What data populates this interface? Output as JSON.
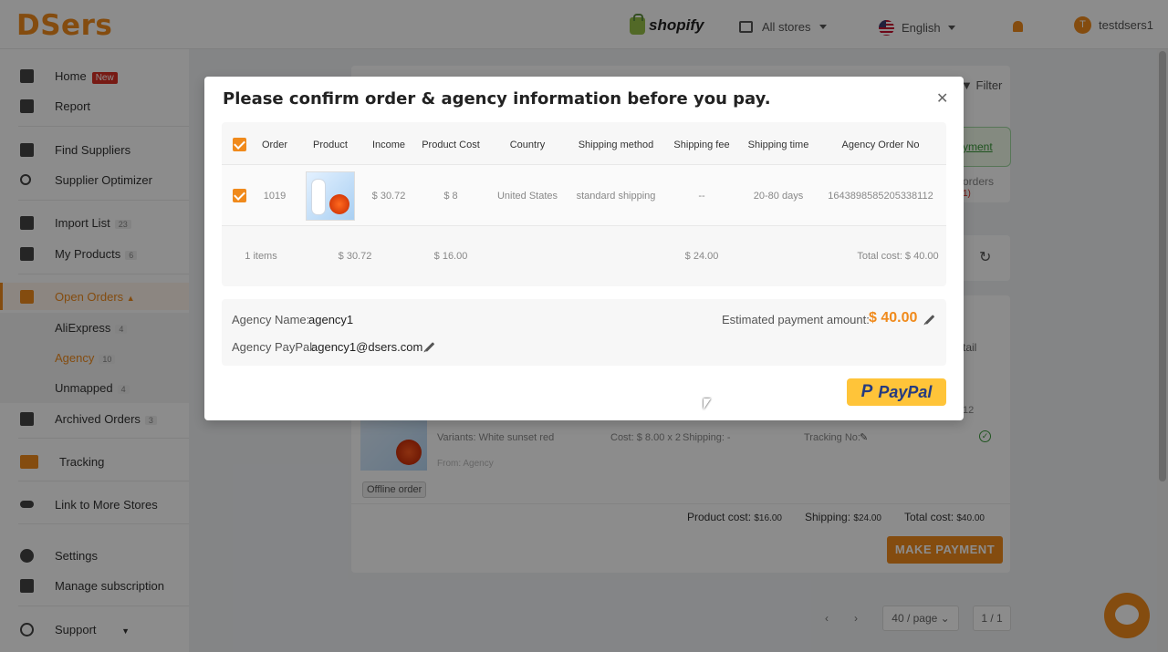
{
  "header": {
    "logo": "DSers",
    "shopify": "shopify",
    "store_selector": "All stores",
    "language": "English",
    "user": "testdsers1",
    "user_initial": "T"
  },
  "sidebar": {
    "home": "Home",
    "home_badge": "New",
    "report": "Report",
    "find_suppliers": "Find Suppliers",
    "supplier_optimizer": "Supplier Optimizer",
    "import_list": "Import List",
    "import_list_count": "23",
    "my_products": "My Products",
    "my_products_count": "6",
    "open_orders": "Open Orders",
    "sub_aliexpress": "AliExpress",
    "sub_aliexpress_count": "4",
    "sub_agency": "Agency",
    "sub_agency_count": "10",
    "sub_unmapped": "Unmapped",
    "sub_unmapped_count": "4",
    "archived_orders": "Archived Orders",
    "archived_orders_count": "3",
    "tracking": "Tracking",
    "link_stores": "Link to More Stores",
    "settings": "Settings",
    "manage_subscription": "Manage subscription",
    "support": "Support"
  },
  "background": {
    "filter": "Filter",
    "payment_fragment": "yment",
    "orders_fragment": "orders",
    "orders_count_fragment": "1)",
    "detail_fragment": "tail",
    "order_no_fragment": "12",
    "variants": "Variants: White sunset red",
    "cost": "Cost: $ 8.00 x 2",
    "shipping": "Shipping: -",
    "tracking_no": "Tracking No:",
    "from": "From: Agency",
    "offline_order": "Offline order",
    "product_cost_label": "Product cost:",
    "product_cost_value": "$16.00",
    "shipping_label": "Shipping:",
    "shipping_value": "$24.00",
    "total_cost_label": "Total cost:",
    "total_cost_value": "$40.00",
    "make_payment": "MAKE PAYMENT",
    "per_page": "40 / page",
    "page_info": "1 / 1"
  },
  "modal": {
    "title": "Please confirm order & agency information before you pay.",
    "columns": [
      "Order",
      "Product",
      "Income",
      "Product Cost",
      "Country",
      "Shipping method",
      "Shipping fee",
      "Shipping time",
      "Agency Order No"
    ],
    "row": {
      "order": "1019",
      "income": "$ 30.72",
      "product_cost": "$ 8",
      "country": "United States",
      "shipping_method": "standard shipping",
      "shipping_fee": "--",
      "shipping_time": "20-80 days",
      "agency_order_no": "1643898585205338112"
    },
    "footer": {
      "items": "1 items",
      "income": "$ 30.72",
      "product_cost": "$ 16.00",
      "shipping_fee": "$ 24.00",
      "total": "Total cost: $ 40.00"
    },
    "agency_name_label": "Agency Name:",
    "agency_name": "agency1",
    "agency_paypal_label": "Agency PayPal:",
    "agency_paypal": "agency1@dsers.com",
    "estimated_label": "Estimated payment amount:",
    "estimated_amount": "$ 40.00",
    "paypal_button": "PayPal"
  }
}
